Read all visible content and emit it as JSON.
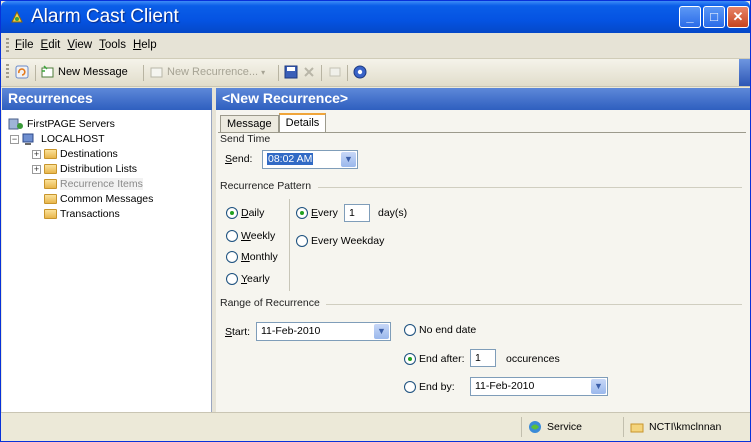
{
  "window": {
    "title": "Alarm Cast Client",
    "minimize_glyph": "_",
    "maximize_glyph": "□",
    "close_glyph": "✕"
  },
  "menu": [
    "File",
    "Edit",
    "View",
    "Tools",
    "Help"
  ],
  "toolbar": {
    "new_message": "New Message",
    "new_recurrence": "New Recurrence..."
  },
  "left": {
    "header": "Recurrences",
    "tree": {
      "root": "FirstPAGE Servers",
      "server": "LOCALHOST",
      "items": [
        "Destinations",
        "Distribution Lists",
        "Recurrence Items",
        "Common Messages",
        "Transactions"
      ]
    }
  },
  "right": {
    "header": "<New Recurrence>",
    "tabs": [
      "Message",
      "Details"
    ],
    "send_time": {
      "title": "Send Time",
      "label": "Send:",
      "value": "08:02 AM"
    },
    "pattern": {
      "title": "Recurrence Pattern",
      "options": [
        "Daily",
        "Weekly",
        "Monthly",
        "Yearly"
      ],
      "every_label": "Every",
      "every_value": "1",
      "every_unit": "day(s)",
      "weekday_label": "Every Weekday"
    },
    "range": {
      "title": "Range of Recurrence",
      "start_label": "Start:",
      "start_value": "11-Feb-2010",
      "no_end": "No end date",
      "end_after": "End after:",
      "end_after_value": "1",
      "occurrences": "occurences",
      "end_by": "End by:",
      "end_by_value": "11-Feb-2010"
    }
  },
  "status": {
    "service": "Service",
    "user": "NCTI\\kmclnnan"
  },
  "colors": {
    "title_bar": "#0553e2",
    "pane_header": "#2f5fbf",
    "radio_selected": "#21a121",
    "selection": "#316ac5"
  }
}
